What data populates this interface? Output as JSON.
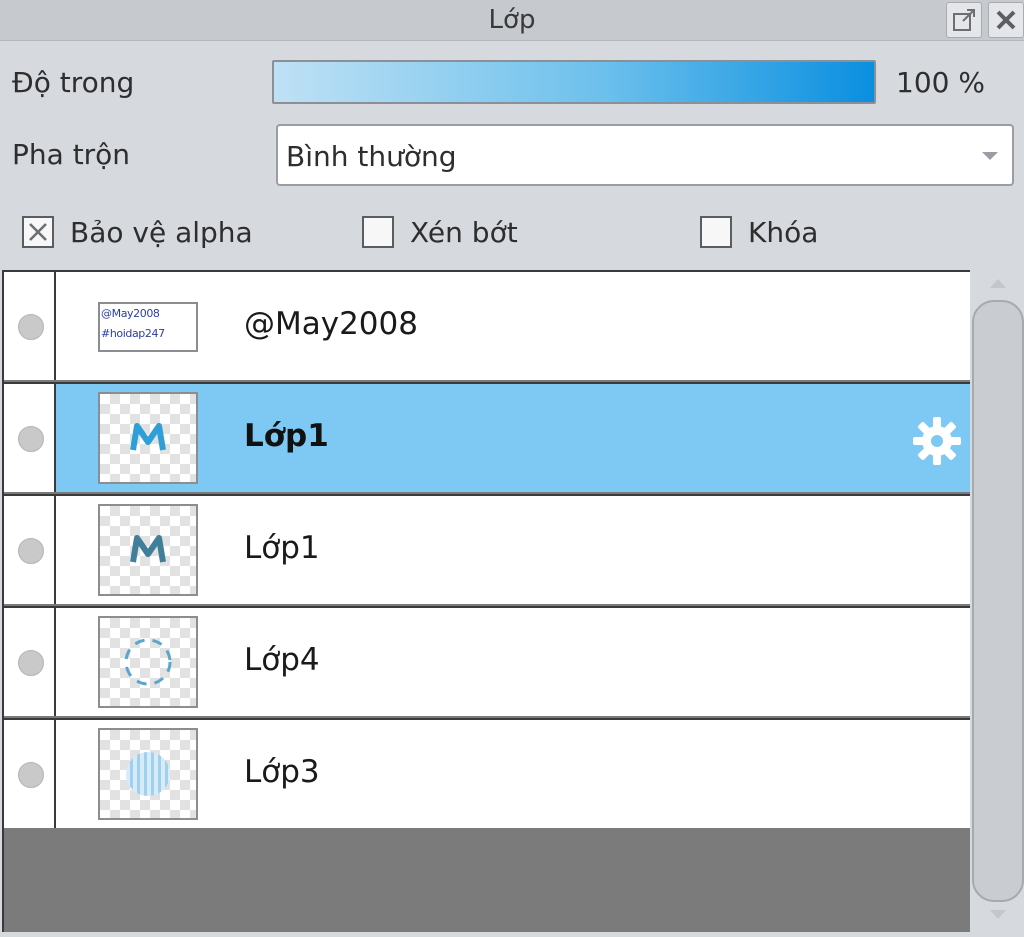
{
  "panel": {
    "title": "Lớp",
    "detach_icon": "detach-icon",
    "close_icon": "close-icon"
  },
  "opacity": {
    "label": "Độ trong",
    "value_text": "100 %",
    "value": 100
  },
  "blend": {
    "label": "Pha trộn",
    "selected": "Bình thường"
  },
  "options": {
    "alpha_protect": {
      "label": "Bảo vệ alpha",
      "checked": true
    },
    "clipping": {
      "label": "Xén bớt",
      "checked": false
    },
    "lock": {
      "label": "Khóa",
      "checked": false
    }
  },
  "layers": [
    {
      "name": "@May2008",
      "thumb": [
        "@May2008",
        "#hoidap247"
      ],
      "selected": false
    },
    {
      "name": "Lớp1",
      "thumb": "letter-m",
      "selected": true,
      "settings_icon": "gear-icon"
    },
    {
      "name": "Lớp1",
      "thumb": "letter-m",
      "selected": false
    },
    {
      "name": "Lớp4",
      "thumb": "dashed-circle",
      "selected": false
    },
    {
      "name": "Lớp3",
      "thumb": "striped-disc",
      "selected": false
    }
  ],
  "colors": {
    "selected_row": "#7ec9f4",
    "opacity_fill": "#0a8fe0",
    "panel_bg": "#d6d9dd"
  }
}
